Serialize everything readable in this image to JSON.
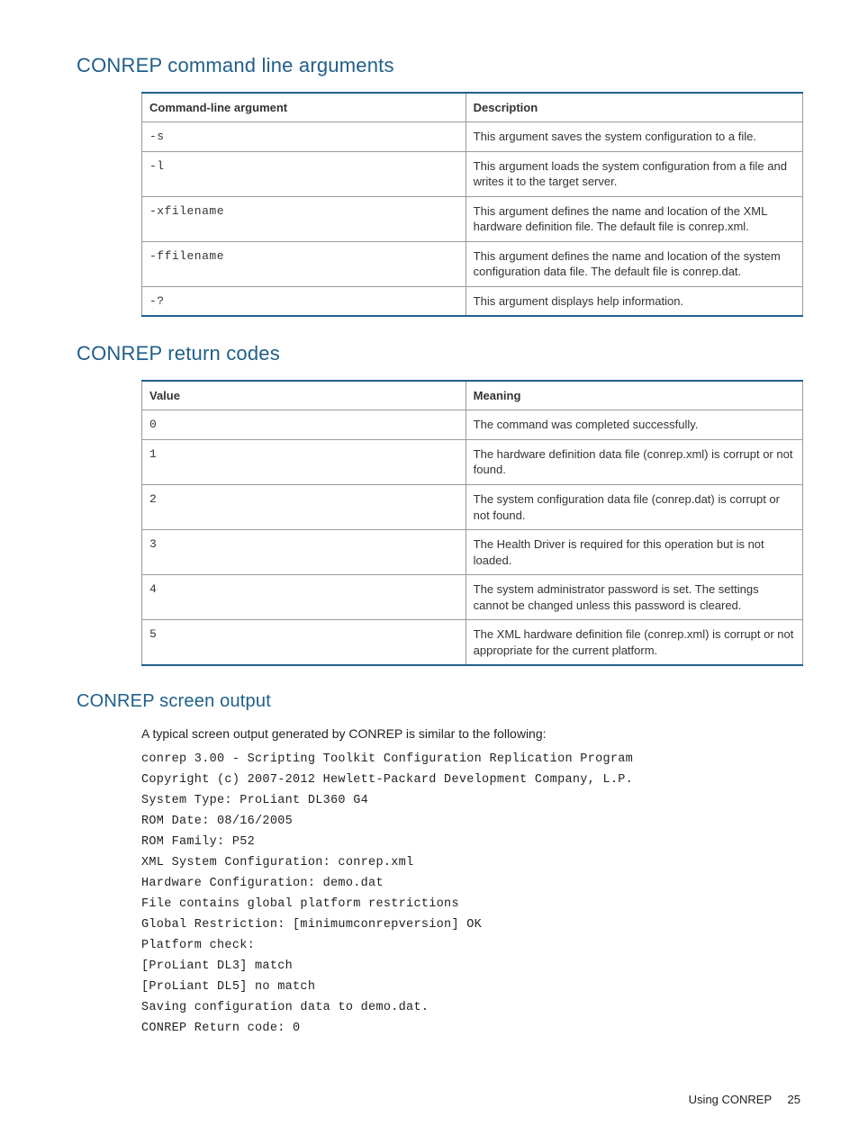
{
  "headings": {
    "args": "CONREP command line arguments",
    "codes": "CONREP return codes",
    "output": "CONREP screen output"
  },
  "args_table": {
    "headers": [
      "Command-line argument",
      "Description"
    ],
    "rows": [
      {
        "arg": "-s",
        "desc": "This argument saves the system configuration to a file."
      },
      {
        "arg": "-l",
        "desc": "This argument loads the system configuration from a file and writes it to the target server."
      },
      {
        "arg": "-xfilename",
        "desc": "This argument defines the name and location of the XML hardware definition file. The default file is conrep.xml."
      },
      {
        "arg": "-ffilename",
        "desc": "This argument defines the name and location of the system configuration data file. The default file is conrep.dat."
      },
      {
        "arg": "-?",
        "desc": "This argument displays help information."
      }
    ]
  },
  "codes_table": {
    "headers": [
      "Value",
      "Meaning"
    ],
    "rows": [
      {
        "val": "0",
        "mean": "The command was completed successfully."
      },
      {
        "val": "1",
        "mean": "The hardware definition data file (conrep.xml) is corrupt or not found."
      },
      {
        "val": "2",
        "mean": "The system configuration data file (conrep.dat) is corrupt or not found."
      },
      {
        "val": "3",
        "mean": "The Health Driver is required for this operation but is not loaded."
      },
      {
        "val": "4",
        "mean": "The system administrator password is set. The settings cannot be changed unless this password is cleared."
      },
      {
        "val": "5",
        "mean": "The XML hardware definition file (conrep.xml) is corrupt or not appropriate for the current platform."
      }
    ]
  },
  "output_intro": "A typical screen output generated by CONREP is similar to the following:",
  "code_lines": [
    "conrep 3.00 - Scripting Toolkit Configuration Replication Program",
    "Copyright (c) 2007-2012 Hewlett-Packard Development Company, L.P.",
    "System Type: ProLiant DL360 G4",
    "ROM Date: 08/16/2005",
    "ROM Family: P52",
    "XML System Configuration: conrep.xml",
    "Hardware Configuration: demo.dat",
    "File contains global platform restrictions",
    "Global Restriction: [minimumconrepversion] OK",
    "Platform check:",
    "[ProLiant DL3] match",
    "[ProLiant DL5] no match",
    "Saving configuration data to demo.dat.",
    "CONREP Return code: 0"
  ],
  "footer": {
    "section": "Using CONREP",
    "page": "25"
  }
}
